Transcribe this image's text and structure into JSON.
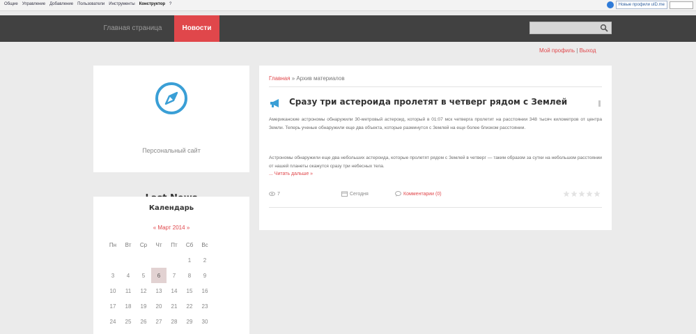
{
  "adminbar": {
    "menu": [
      "Общие",
      "Управление",
      "Добавление",
      "Пользователи",
      "Инструменты",
      "Конструктор",
      "?"
    ],
    "active_index": 5,
    "new_profile_label": "Новые профили uID.me"
  },
  "nav": {
    "home_label": "Главная страница",
    "news_label": "Новости",
    "search_placeholder": ""
  },
  "profile": {
    "my_profile": "Мой профиль",
    "separator": "|",
    "logout": "Выход"
  },
  "site": {
    "name": "Last News",
    "description": "Персональный сайт",
    "logo_icon": "compass-icon",
    "accent": "#3a9fd6"
  },
  "calendar": {
    "title": "Календарь",
    "month_prev": "«",
    "month": "Март 2014",
    "month_next": "»",
    "weekdays": [
      "Пн",
      "Вт",
      "Ср",
      "Чт",
      "Пт",
      "Сб",
      "Вс"
    ],
    "weeks": [
      [
        "",
        "",
        "",
        "",
        "",
        "1",
        "2"
      ],
      [
        "3",
        "4",
        "5",
        "6",
        "7",
        "8",
        "9"
      ],
      [
        "10",
        "11",
        "12",
        "13",
        "14",
        "15",
        "16"
      ],
      [
        "17",
        "18",
        "19",
        "20",
        "21",
        "22",
        "23"
      ],
      [
        "24",
        "25",
        "26",
        "27",
        "28",
        "29",
        "30"
      ]
    ],
    "today": "6"
  },
  "breadcrumb": {
    "home": "Главная",
    "separator": "»",
    "current": "Архив материалов"
  },
  "post": {
    "title": "Сразу три астероида пролетят в четверг рядом с Землей",
    "paragraph1": "Американские астрономы обнаружили 30-метровый астероид, который в 01:07 мск четверга пролетит на расстоянии 348 тысяч километров от центра Земли. Теперь ученые обнаружили еще два объекта, которые разминутся с Землей на еще более близком расстоянии.",
    "paragraph2": "Астрономы обнаружили еще два небольших астероида, которые пролетят рядом с Землей в четверг — таким образом за сутки на небольшом расстоянии от нашей планеты окажутся сразу три небесных тела.",
    "read_more": "... Читать дальше »",
    "views": "7",
    "date": "Сегодня",
    "comments": "Комментарии (0)",
    "rating_stars": 5
  },
  "colors": {
    "accent_red": "#e0474b",
    "navbar_bg": "#414141",
    "page_bg": "#ebebeb"
  }
}
